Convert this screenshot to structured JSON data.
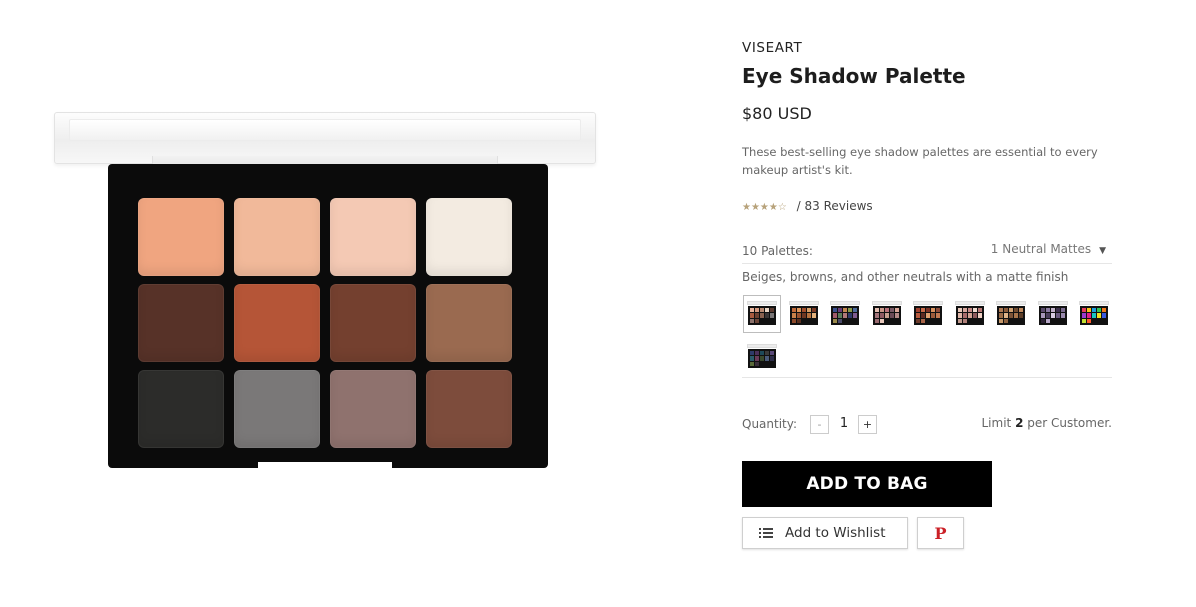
{
  "product": {
    "brand": "VISEART",
    "title": "Eye Shadow Palette",
    "price": "$80 USD",
    "description": "These best-selling eye shadow palettes are essential to every makeup artist's kit.",
    "rating_value": 4.5,
    "rating_stars": "★★★★☆",
    "reviews_text": "/ 83 Reviews"
  },
  "image": {
    "pan_colors": [
      "#f0a580",
      "#f1b99a",
      "#f4c9b4",
      "#f3ebe1",
      "#573228",
      "#b55537",
      "#74402f",
      "#9a6a50",
      "#2c2c2a",
      "#7a7878",
      "#8f726e",
      "#7d4c3c"
    ]
  },
  "variant": {
    "label": "10 Palettes:",
    "selected": "1 Neutral Mattes",
    "description": "Beiges, browns, and other neutrals with a matte finish",
    "swatches": [
      {
        "colors": [
          "#e8b39a",
          "#d69c82",
          "#b98a72",
          "#e9d6c6",
          "#5b3a30",
          "#a85a3e",
          "#6d4030",
          "#8a6250",
          "#3a3636",
          "#7a7677",
          "#8d736d",
          "#6c4538"
        ]
      },
      {
        "colors": [
          "#c16a3a",
          "#e0975a",
          "#a34e2c",
          "#d7a168",
          "#7c3a25",
          "#c9814a",
          "#9b5330",
          "#6e3722",
          "#b8723e",
          "#e3b07a",
          "#8e4a2a",
          "#5a2f1e"
        ]
      },
      {
        "colors": [
          "#3a4f8c",
          "#6a3d7a",
          "#c28752",
          "#8a9a4a",
          "#4c6a9a",
          "#a05a6a",
          "#5a7a5a",
          "#b0787a",
          "#2e3a6a",
          "#7e5a8e",
          "#9a8a4a",
          "#4a4a6a"
        ]
      },
      {
        "colors": [
          "#e4bdb0",
          "#c99688",
          "#b8707a",
          "#7a5a66",
          "#d9a79a",
          "#a3747a",
          "#8e5a62",
          "#c8a090",
          "#6a4a56",
          "#b58a88",
          "#9a6a70",
          "#e8c8bc"
        ]
      },
      {
        "colors": [
          "#a0402e",
          "#c86a4a",
          "#7a3024",
          "#d9905e",
          "#8c4a38",
          "#b85a3e",
          "#5e2a22",
          "#e0a070",
          "#9c5a3a",
          "#c47a52",
          "#6e3a2a",
          "#a86448"
        ]
      },
      {
        "colors": [
          "#e9c9bb",
          "#d8a9a0",
          "#c78a88",
          "#f1dcd2",
          "#b87876",
          "#e2b8aa",
          "#a86a6a",
          "#d4a394",
          "#8e5a5c",
          "#f0d0c4",
          "#c29a8e",
          "#b0807a"
        ]
      },
      {
        "colors": [
          "#b07a54",
          "#8a5a3a",
          "#d0a070",
          "#6e4a30",
          "#c08a5e",
          "#9a6a44",
          "#e0b488",
          "#7a5236",
          "#a8764c",
          "#5e3e28",
          "#c89a6c",
          "#8e6240"
        ]
      },
      {
        "colors": [
          "#5a4a6a",
          "#8a7aa0",
          "#c0b0c8",
          "#3a2e4a",
          "#7a6a8e",
          "#a898b8",
          "#4a3e5a",
          "#d8cce0",
          "#6a5a7e",
          "#9a8aae",
          "#2e2438",
          "#b8a8c8"
        ]
      },
      {
        "colors": [
          "#e83a5a",
          "#f5c518",
          "#1aa0e0",
          "#2ec45a",
          "#f07a1a",
          "#9a3ad0",
          "#e01e8a",
          "#18c4c0",
          "#f0e020",
          "#3a5ae0",
          "#c0e030",
          "#ff5a2a"
        ]
      },
      {
        "colors": [
          "#2e3a6a",
          "#4a2e5a",
          "#1e4a5a",
          "#3a3a3a",
          "#5a4a7a",
          "#2a5a6a",
          "#6a3a5a",
          "#3a4a2e",
          "#4a5a7a",
          "#2e2e4a",
          "#5a6a3a",
          "#3a2e3a"
        ]
      }
    ]
  },
  "quantity": {
    "label": "Quantity:",
    "minus": "-",
    "value": "1",
    "plus": "+",
    "limit_prefix": "Limit ",
    "limit_number": "2",
    "limit_suffix": " per Customer."
  },
  "actions": {
    "add_to_bag": "ADD TO BAG",
    "wishlist": "Add to Wishlist",
    "pinterest_glyph": "P",
    "pinterest_color": "#cb2027"
  }
}
